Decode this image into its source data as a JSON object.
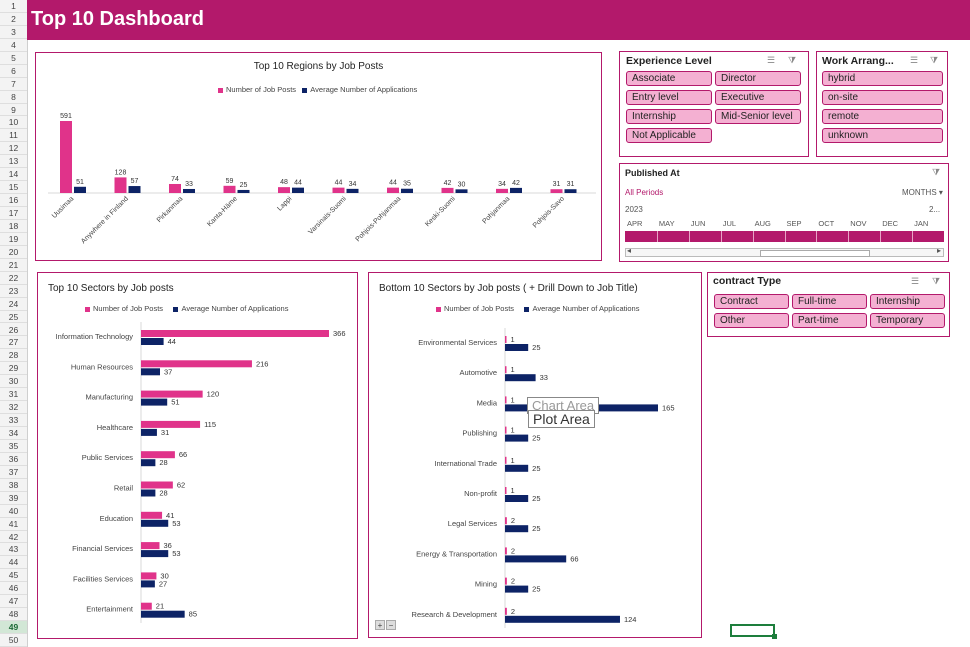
{
  "dashboard": {
    "title": "Top 10 Dashboard"
  },
  "row_numbers": [
    "1",
    "2",
    "3",
    "4",
    "5",
    "6",
    "7",
    "8",
    "9",
    "10",
    "11",
    "12",
    "13",
    "14",
    "15",
    "16",
    "17",
    "18",
    "19",
    "20",
    "21",
    "22",
    "23",
    "24",
    "25",
    "26",
    "27",
    "28",
    "29",
    "30",
    "31",
    "32",
    "33",
    "34",
    "35",
    "36",
    "37",
    "38",
    "39",
    "40",
    "41",
    "42",
    "43",
    "44",
    "45",
    "46",
    "47",
    "48",
    "49",
    "50"
  ],
  "selected_row": "49",
  "colors": {
    "accent": "#b3196b",
    "pink_series": "#e0338a",
    "navy_series": "#0d2366",
    "slicer_button": "#f4b0d2"
  },
  "legend": {
    "jobs": "Number of Job Posts",
    "apps": "Average Number of Applications"
  },
  "chart_data": [
    {
      "type": "bar",
      "title": "Top 10 Regions by Job Posts",
      "categories": [
        "Uusimaa",
        "Anywhere in Finland",
        "Pirkanmaa",
        "Kanta-Häme",
        "Lappi",
        "Varsinais-Suomi",
        "Pohjois-Pohjanmaa",
        "Keski-Suomi",
        "Pohjanmaa",
        "Pohjois-Savo"
      ],
      "series": [
        {
          "name": "Number of Job Posts",
          "values": [
            591,
            128,
            74,
            59,
            48,
            44,
            44,
            42,
            34,
            31
          ]
        },
        {
          "name": "Average Number of Applications",
          "values": [
            51,
            57,
            33,
            25,
            44,
            34,
            35,
            30,
            42,
            31
          ]
        }
      ]
    },
    {
      "type": "bar",
      "title": "Top 10 Sectors by Job posts",
      "categories": [
        "Information Technology",
        "Human Resources",
        "Manufacturing",
        "Healthcare",
        "Public Services",
        "Retail",
        "Education",
        "Financial Services",
        "Facilities Services",
        "Entertainment"
      ],
      "series": [
        {
          "name": "Number of Job Posts",
          "values": [
            366,
            216,
            120,
            115,
            66,
            62,
            41,
            36,
            30,
            21
          ]
        },
        {
          "name": "Average Number of Applications",
          "values": [
            44,
            37,
            51,
            31,
            28,
            28,
            53,
            53,
            27,
            85
          ]
        }
      ]
    },
    {
      "type": "bar",
      "title": "Bottom 10 Sectors by Job posts ( + Drill Down to Job Title)",
      "categories": [
        "Environmental Services",
        "Automotive",
        "Media",
        "Publishing",
        "International Trade",
        "Non-profit",
        "Legal Services",
        "Energy & Transportation",
        "Mining",
        "Research & Development"
      ],
      "series": [
        {
          "name": "Number of Job Posts",
          "values": [
            1,
            1,
            1,
            1,
            1,
            1,
            2,
            2,
            2,
            2
          ]
        },
        {
          "name": "Average Number of Applications",
          "values": [
            25,
            33,
            165,
            25,
            25,
            25,
            25,
            66,
            25,
            124
          ]
        }
      ]
    }
  ],
  "tooltip": {
    "chart_area": "Chart Area",
    "plot_area": "Plot Area"
  },
  "slicers": {
    "experience": {
      "title": "Experience Level",
      "items": [
        "Associate",
        "Director",
        "Entry level",
        "Executive",
        "Internship",
        "Mid-Senior level",
        "Not Applicable"
      ]
    },
    "work": {
      "title": "Work Arrang...",
      "items": [
        "hybrid",
        "on-site",
        "remote",
        "unknown"
      ]
    },
    "contract": {
      "title": "contract Type",
      "items": [
        "Contract",
        "Full-time",
        "Internship",
        "Other",
        "Part-time",
        "Temporary"
      ]
    }
  },
  "timeline": {
    "title": "Published  At",
    "all_periods": "All Periods",
    "level": "MONTHS",
    "year": "2023",
    "year_end": "2...",
    "months": [
      "APR",
      "MAY",
      "JUN",
      "JUL",
      "AUG",
      "SEP",
      "OCT",
      "NOV",
      "DEC",
      "JAN"
    ]
  }
}
